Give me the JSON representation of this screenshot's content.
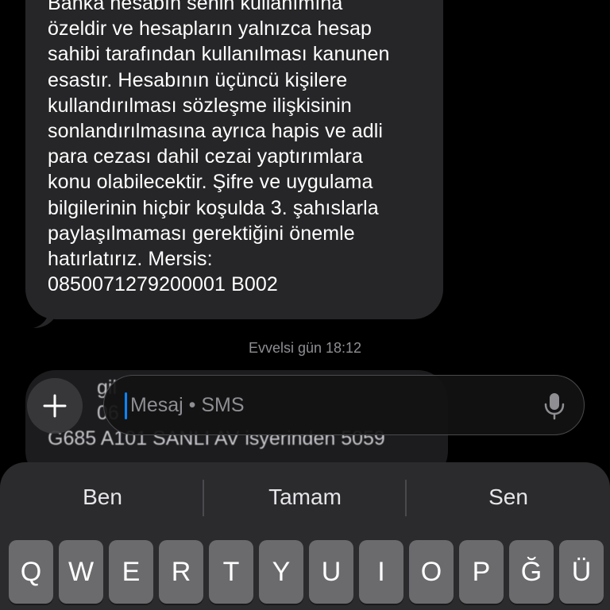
{
  "message": {
    "lines": [
      "Banka hesabın senin kullanımına",
      "özeldir ve hesapların yalnızca hesap",
      "sahibi tarafından kullanılması kanunen",
      "esastır. Hesabının üçüncü kişilere",
      "kullandırılması sözleşme ilişkisinin",
      "sonlandırılmasına ayrıca hapis ve adli",
      "para cezası dahil cezai yaptırımlara",
      "konu olabilecektir. Şifre ve uygulama",
      "bilgilerinin hiçbir koşulda 3. şahıslarla",
      "paylaşılmaması gerektiğini önemle",
      "hatırlatırız. Mersis:",
      "0850071279200001 B002"
    ]
  },
  "timestamp": "Evvelsi gün 18:12",
  "partial_message": {
    "lines": [
      "gil",
      "06",
      "G685 A101 SANLI AV isyerinden 5059"
    ]
  },
  "compose": {
    "placeholder": "Mesaj • SMS",
    "plus_icon": "plus-icon",
    "mic_icon": "microphone-icon"
  },
  "keyboard": {
    "suggestions": [
      "Ben",
      "Tamam",
      "Sen"
    ],
    "row1": [
      "Q",
      "W",
      "E",
      "R",
      "T",
      "Y",
      "U",
      "I",
      "O",
      "P",
      "Ğ",
      "Ü"
    ]
  },
  "colors": {
    "background": "#000000",
    "bubble": "#262628",
    "caret": "#0a84ff",
    "key": "#6b6b6e"
  }
}
